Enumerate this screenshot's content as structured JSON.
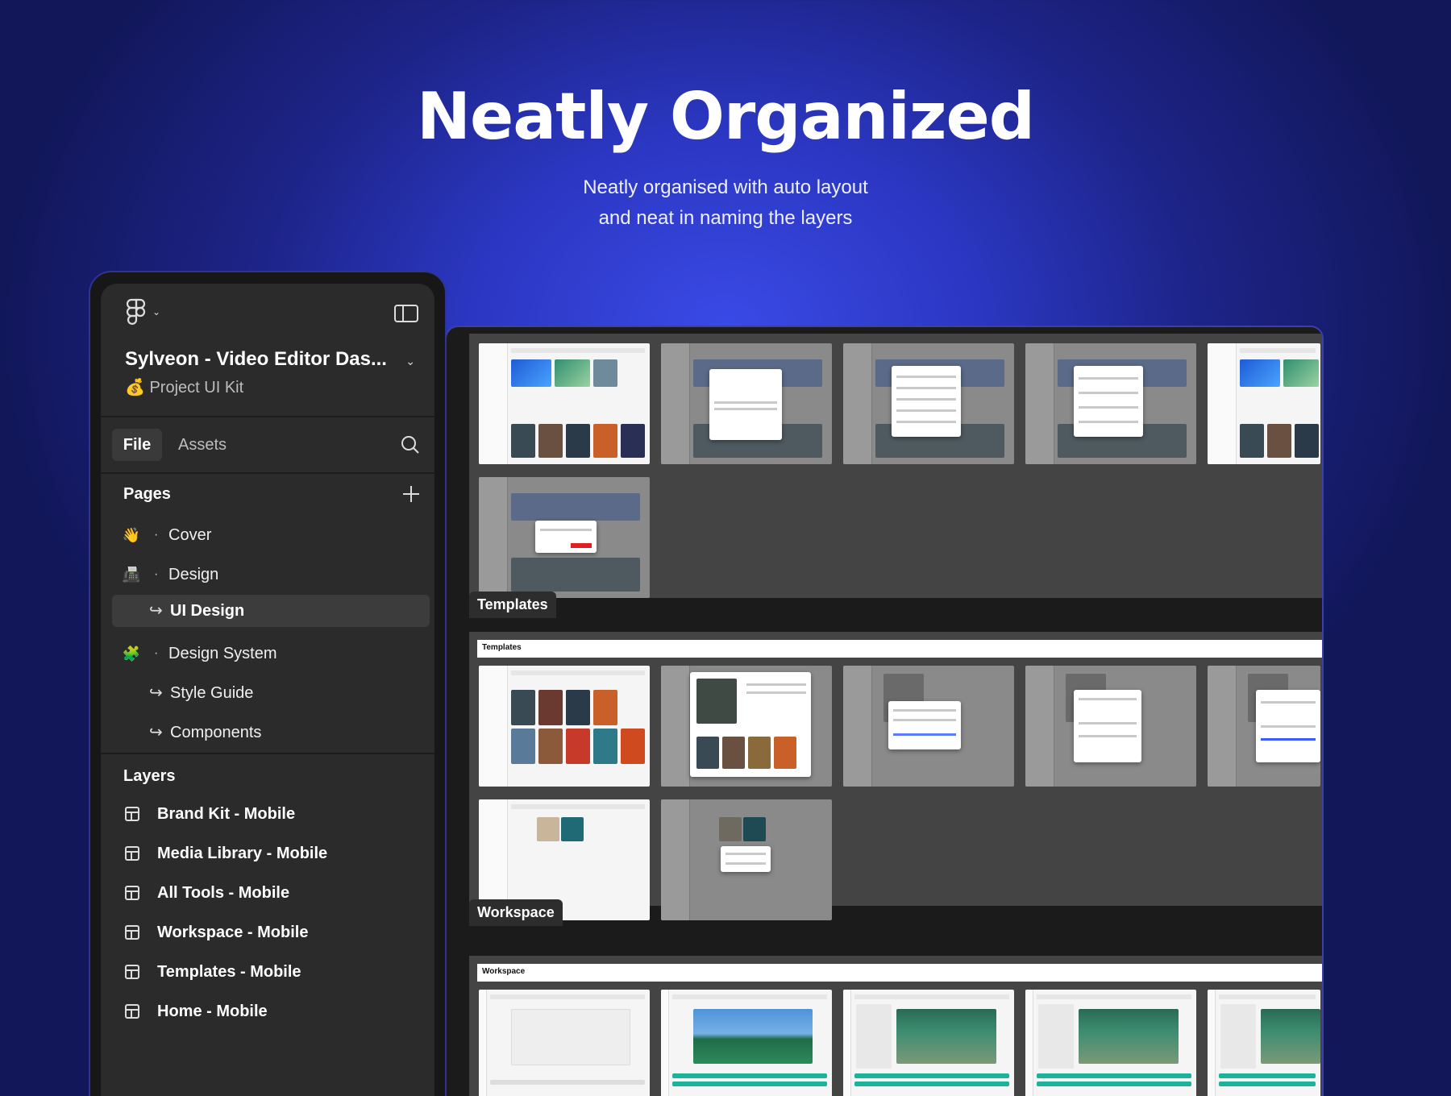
{
  "hero": {
    "title": "Neatly Organized",
    "subtitle_line1": "Neatly organised with auto layout",
    "subtitle_line2": "and neat in naming the layers"
  },
  "panel": {
    "project_title": "Sylveon - Video Editor Das...",
    "project_subtitle": "💰 Project UI Kit",
    "tabs": {
      "file": "File",
      "assets": "Assets"
    },
    "pages_label": "Pages",
    "pages": [
      {
        "emoji": "👋",
        "label": "Cover"
      },
      {
        "emoji": "📠",
        "label": "Design"
      },
      {
        "label": "UI Design",
        "selected": true
      },
      {
        "emoji": "🧩",
        "label": "Design System"
      },
      {
        "label": "Style Guide"
      },
      {
        "label": "Components"
      }
    ],
    "layers_label": "Layers",
    "layers": [
      "Brand Kit - Mobile",
      "Media Library - Mobile",
      "All Tools - Mobile",
      "Workspace - Mobile",
      "Templates - Mobile",
      "Home - Mobile"
    ]
  },
  "canvas": {
    "section_labels": {
      "templates": "Templates",
      "workspace": "Workspace"
    },
    "section_headers": {
      "templates": "Templates",
      "workspace": "Workspace"
    }
  },
  "icons": {
    "logo": "figma-logo-icon",
    "sidebar_toggle": "sidebar-toggle-icon",
    "search": "search-icon",
    "add_page": "plus-icon",
    "frame": "frame-icon",
    "page_link": "return-arrow-icon"
  }
}
